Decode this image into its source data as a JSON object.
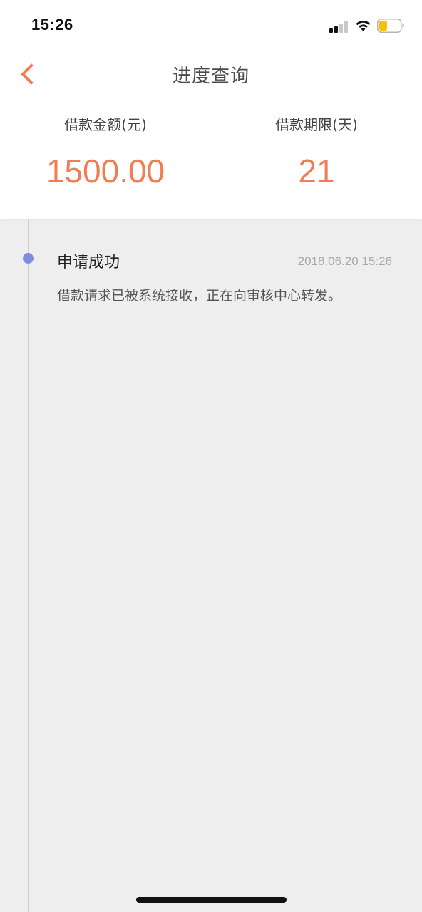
{
  "status_bar": {
    "time": "15:26",
    "icons": [
      "cellular-signal-icon",
      "wifi-icon",
      "battery-icon"
    ],
    "battery_color": "#f5c400"
  },
  "nav": {
    "back_icon": "chevron-left-icon",
    "title": "进度查询"
  },
  "summary": {
    "amount_label": "借款金额(元)",
    "amount_value": "1500.00",
    "term_label": "借款期限(天)",
    "term_value": "21"
  },
  "timeline": {
    "events": [
      {
        "title": "申请成功",
        "time": "2018.06.20 15:26",
        "description": "借款请求已被系统接收，正在向审核中心转发。"
      }
    ]
  },
  "colors": {
    "accent": "#f07e55",
    "dot": "#7d8ee0",
    "background": "#eeeeee"
  }
}
